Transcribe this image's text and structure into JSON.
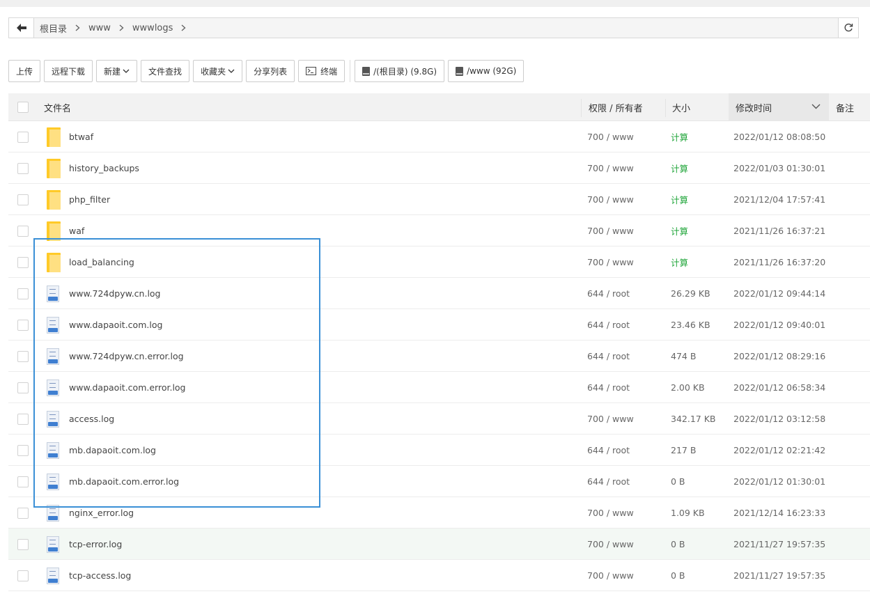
{
  "path": {
    "crumbs": [
      "根目录",
      "www",
      "wwwlogs"
    ]
  },
  "toolbar": {
    "upload": "上传",
    "remote_download": "远程下载",
    "new": "新建",
    "file_search": "文件查找",
    "favorites": "收藏夹",
    "share_list": "分享列表",
    "terminal": "终端",
    "disk_root": "/(根目录) (9.8G)",
    "disk_www": "/www (92G)"
  },
  "table": {
    "headers": {
      "name": "文件名",
      "perm": "权限 / 所有者",
      "size": "大小",
      "mtime": "修改时间",
      "note": "备注"
    },
    "rows": [
      {
        "type": "folder",
        "name": "btwaf",
        "perm": "700 / www",
        "size": "计算",
        "mtime": "2022/01/12 08:08:50"
      },
      {
        "type": "folder",
        "name": "history_backups",
        "perm": "700 / www",
        "size": "计算",
        "mtime": "2022/01/03 01:30:01"
      },
      {
        "type": "folder",
        "name": "php_filter",
        "perm": "700 / www",
        "size": "计算",
        "mtime": "2021/12/04 17:57:41"
      },
      {
        "type": "folder",
        "name": "waf",
        "perm": "700 / www",
        "size": "计算",
        "mtime": "2021/11/26 16:37:21"
      },
      {
        "type": "folder",
        "name": "load_balancing",
        "perm": "700 / www",
        "size": "计算",
        "mtime": "2021/11/26 16:37:20"
      },
      {
        "type": "log",
        "name": "www.724dpyw.cn.log",
        "perm": "644 / root",
        "size": "26.29 KB",
        "mtime": "2022/01/12 09:44:14"
      },
      {
        "type": "log",
        "name": "www.dapaoit.com.log",
        "perm": "644 / root",
        "size": "23.46 KB",
        "mtime": "2022/01/12 09:40:01"
      },
      {
        "type": "log",
        "name": "www.724dpyw.cn.error.log",
        "perm": "644 / root",
        "size": "474 B",
        "mtime": "2022/01/12 08:29:16"
      },
      {
        "type": "log",
        "name": "www.dapaoit.com.error.log",
        "perm": "644 / root",
        "size": "2.00 KB",
        "mtime": "2022/01/12 06:58:34"
      },
      {
        "type": "log",
        "name": "access.log",
        "perm": "700 / www",
        "size": "342.17 KB",
        "mtime": "2022/01/12 03:12:58"
      },
      {
        "type": "log",
        "name": "mb.dapaoit.com.log",
        "perm": "644 / root",
        "size": "217 B",
        "mtime": "2022/01/12 02:21:42"
      },
      {
        "type": "log",
        "name": "mb.dapaoit.com.error.log",
        "perm": "644 / root",
        "size": "0 B",
        "mtime": "2022/01/12 01:30:01"
      },
      {
        "type": "log",
        "name": "nginx_error.log",
        "perm": "700 / www",
        "size": "1.09 KB",
        "mtime": "2021/12/14 16:23:33"
      },
      {
        "type": "log",
        "name": "tcp-error.log",
        "perm": "700 / www",
        "size": "0 B",
        "mtime": "2021/11/27 19:57:35",
        "hover": true
      },
      {
        "type": "log",
        "name": "tcp-access.log",
        "perm": "700 / www",
        "size": "0 B",
        "mtime": "2021/11/27 19:57:35"
      }
    ]
  },
  "colors": {
    "calc": "#20a53a",
    "highlight_border": "#3a8fd6",
    "folder": "#ffca28",
    "log_tag": "#3f7fd1"
  }
}
